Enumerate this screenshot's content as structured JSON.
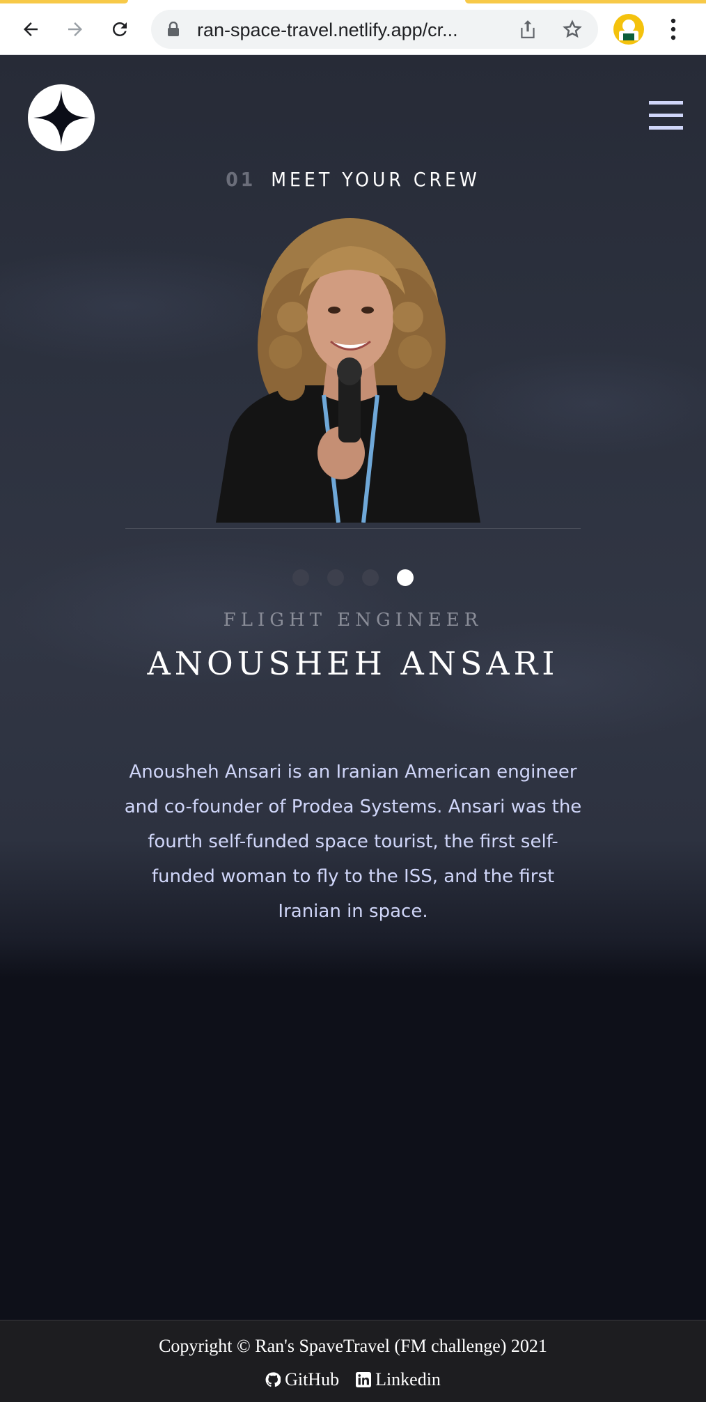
{
  "browser": {
    "url": "ran-space-travel.netlify.app/cr...",
    "icons": [
      "back-icon",
      "forward-icon",
      "reload-icon",
      "lock-icon",
      "share-icon",
      "bookmark-star-icon",
      "profile-avatar",
      "more-menu-icon"
    ]
  },
  "header": {
    "logo_icon": "four-point-star-icon",
    "menu_icon": "hamburger-icon"
  },
  "section": {
    "number": "01",
    "title": "MEET YOUR CREW"
  },
  "crew": {
    "role": "FLIGHT ENGINEER",
    "name": "ANOUSHEH ANSARI",
    "bio_lines": [
      "Anousheh Ansari is an Iranian American engineer",
      "and co-founder of Prodea Systems. Ansari was the",
      "fourth self-funded space tourist, the first self-",
      "funded woman to fly to the ISS, and the first",
      "Iranian in space."
    ],
    "dots_count": 4,
    "active_dot": 4
  },
  "footer": {
    "copyright": "Copyright © Ran's SpaveTravel (FM challenge) 2021",
    "links": [
      {
        "label": "GitHub",
        "icon": "github-icon"
      },
      {
        "label": "Linkedin",
        "icon": "linkedin-icon"
      }
    ]
  },
  "colors": {
    "accent_light": "#d0d6f9",
    "dark_bg": "#0b0d17",
    "chrome_yellow": "#f7c948"
  }
}
